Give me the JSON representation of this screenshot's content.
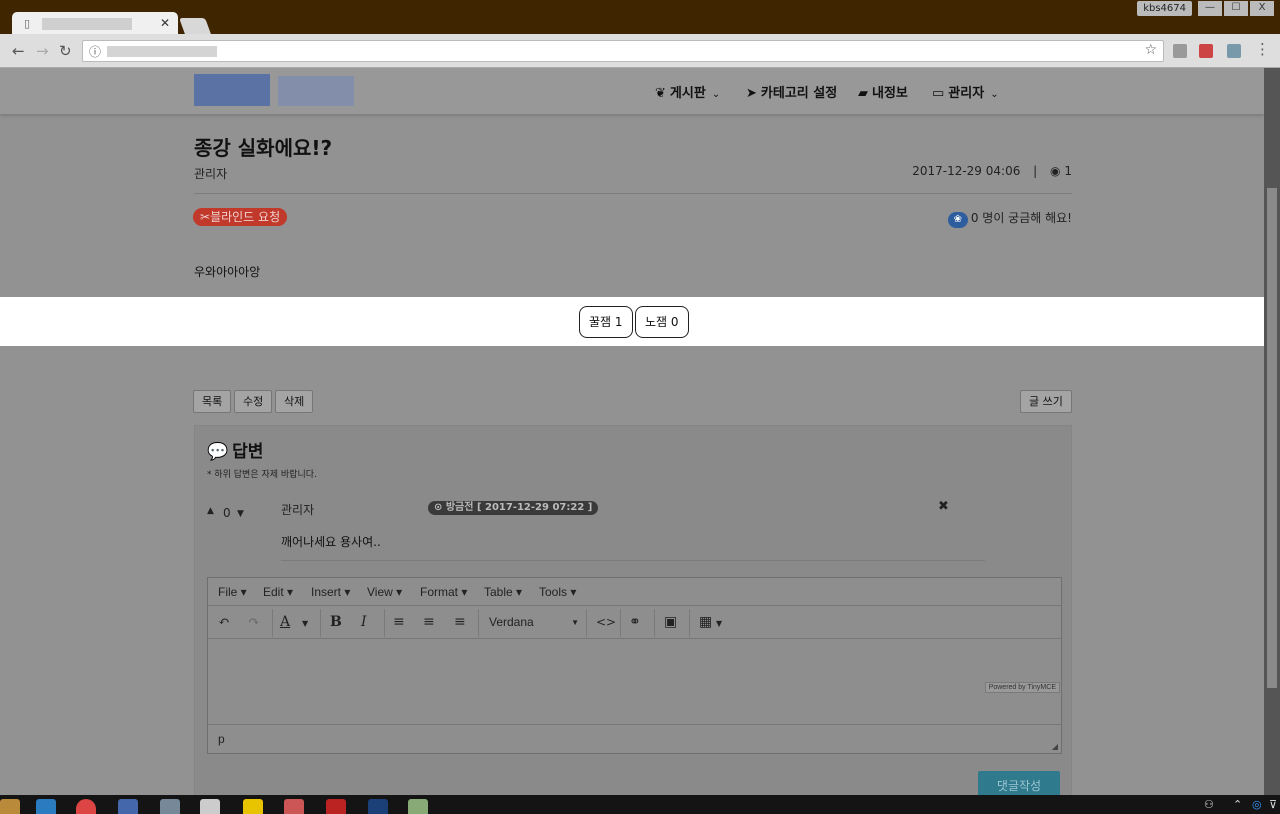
{
  "browser": {
    "close_glyph": "✕",
    "user_badge": "kbs4674",
    "window_buttons": [
      "—",
      "☐",
      "X"
    ]
  },
  "nav": {
    "items": [
      {
        "icon": "leaf-icon",
        "glyph": "❦",
        "label": "게시판",
        "caret": "⌄"
      },
      {
        "icon": "paper-plane-icon",
        "glyph": "➤",
        "label": "카테고리 설정",
        "caret": ""
      },
      {
        "icon": "book-icon",
        "glyph": "▰",
        "label": "내정보",
        "caret": ""
      },
      {
        "icon": "id-card-icon",
        "glyph": "▭",
        "label": "관리자",
        "caret": "⌄"
      }
    ]
  },
  "post": {
    "title": "종강 실화에요!?",
    "author": "관리자",
    "date": "2017-12-29 04:06",
    "separator": "|",
    "views": "1",
    "blind_request": "블라인드 요청",
    "curious_text": "0 명이 궁금해 해요!",
    "body": "우와아아아앙"
  },
  "votes": {
    "honey_label": "꿀잼 1",
    "no_fun_label": "노잼 0"
  },
  "actions": {
    "list": "목록",
    "edit": "수정",
    "delete": "삭제",
    "write": "글 쓰기"
  },
  "replies": {
    "heading": "답변",
    "note": "* 하위 답변은 자제 바랍니다.",
    "comment": {
      "up": "▲",
      "count": "0",
      "down": "▼",
      "author": "관리자",
      "badge": "⊙ 방금전 [ 2017-12-29 07:22 ]",
      "delete": "✖",
      "body": "깨어나세요 용사여.."
    }
  },
  "editor": {
    "menus": [
      "File",
      "Edit",
      "Insert",
      "View",
      "Format",
      "Table",
      "Tools"
    ],
    "font": "Verdana",
    "powered": "Powered by TinyMCE",
    "path": "p",
    "submit": "댓글작성"
  },
  "colors": {
    "chrome": "#3f2500",
    "overlay": "#929292",
    "danger": "#c0392b",
    "primary": "#2f7a8c"
  }
}
